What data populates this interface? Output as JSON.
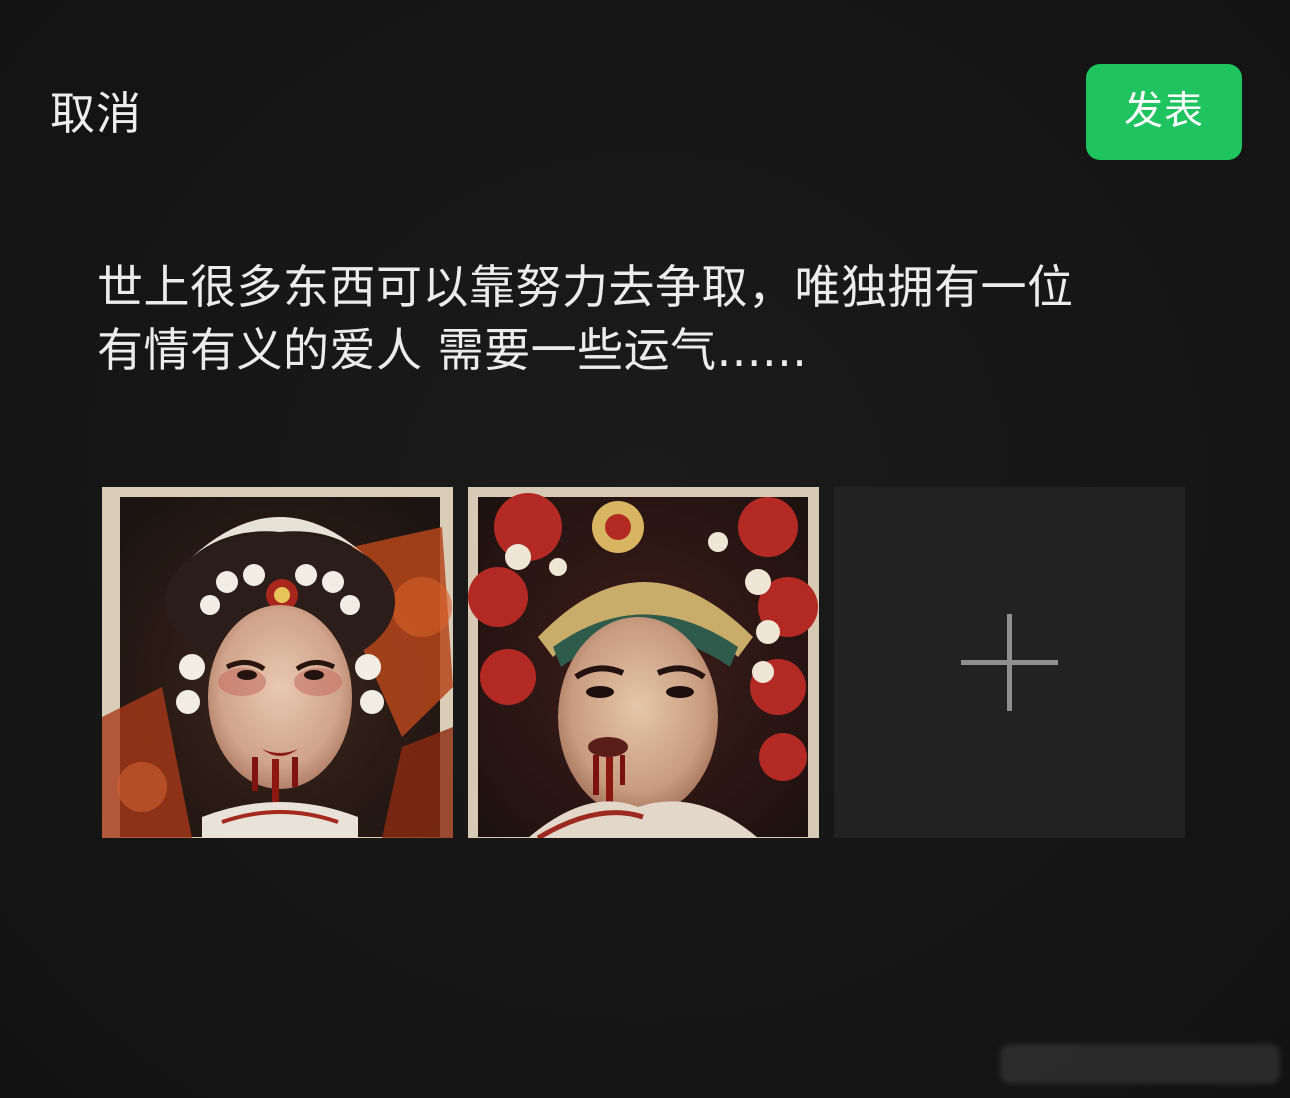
{
  "header": {
    "cancel_label": "取消",
    "publish_label": "发表"
  },
  "post": {
    "text": "世上很多东西可以靠努力去争取，唯独拥有一位\n有情有义的爱人 需要一些运气......"
  },
  "media": {
    "images": [
      {
        "alt": "Opera portrait with ornate white-beaded headdress, blood on chin"
      },
      {
        "alt": "Opera portrait with red pom-pom and pearl headdress, blood dripping from mouth"
      }
    ],
    "add_tile_icon": "plus-icon"
  },
  "colors": {
    "background": "#161616",
    "publish_button": "#1fc35f",
    "add_tile": "#222222",
    "text": "#ececec"
  }
}
